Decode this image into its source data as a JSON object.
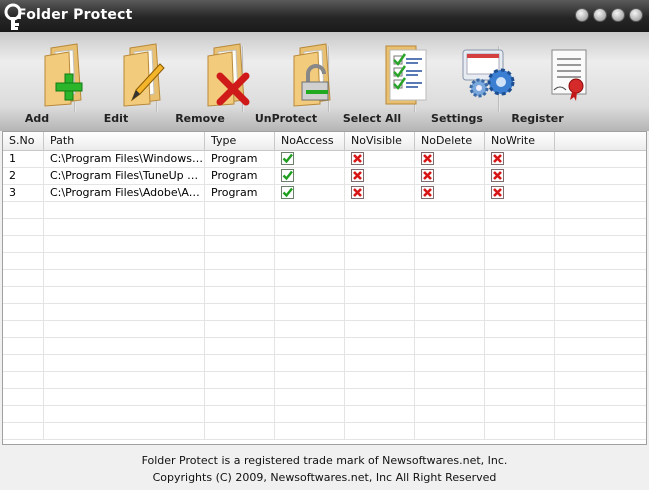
{
  "app": {
    "title": "Folder Protect",
    "window_buttons": [
      "help-icon",
      "minimize-icon",
      "maximize-icon",
      "close-icon"
    ]
  },
  "toolbar": [
    {
      "label": "Add",
      "icon": "folder-add-icon",
      "width": 74
    },
    {
      "label": "Edit",
      "icon": "folder-edit-icon",
      "width": 80
    },
    {
      "label": "Remove",
      "icon": "folder-remove-icon",
      "width": 84
    },
    {
      "label": "UnProtect",
      "icon": "folder-unlock-icon",
      "width": 84
    },
    {
      "label": "Select All",
      "icon": "checklist-icon",
      "width": 84
    },
    {
      "label": "Settings",
      "icon": "settings-gears-icon",
      "width": 82
    },
    {
      "label": "Register",
      "icon": "certificate-icon",
      "width": 75
    }
  ],
  "table": {
    "columns": [
      "S.No",
      "Path",
      "Type",
      "NoAccess",
      "NoVisible",
      "NoDelete",
      "NoWrite",
      ""
    ],
    "rows": [
      {
        "sno": "1",
        "path": "C:\\Program Files\\Windows N...",
        "type": "Program",
        "noaccess": true,
        "novisible": false,
        "nodelete": false,
        "nowrite": false
      },
      {
        "sno": "2",
        "path": "C:\\Program Files\\TuneUp Uti...",
        "type": "Program",
        "noaccess": true,
        "novisible": false,
        "nodelete": false,
        "nowrite": false
      },
      {
        "sno": "3",
        "path": "C:\\Program Files\\Adobe\\Ado...",
        "type": "Program",
        "noaccess": true,
        "novisible": false,
        "nodelete": false,
        "nowrite": false
      }
    ],
    "empty_rows": 14
  },
  "footer": {
    "line1": "Folder Protect is a registered trade mark of Newsoftwares.net, Inc.",
    "line2": "Copyrights (C) 2009, Newsoftwares.net, Inc All Right Reserved"
  },
  "colors": {
    "check": "#1e9e1e",
    "cross": "#d81515",
    "titlebar": "#262626"
  }
}
